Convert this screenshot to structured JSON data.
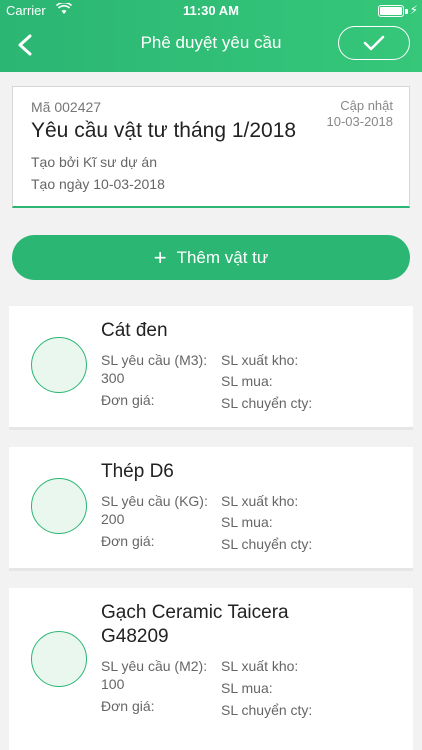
{
  "status_bar": {
    "carrier": "Carrier",
    "time": "11:30 AM"
  },
  "header": {
    "title": "Phê duyệt yêu cầu",
    "back_icon": "chevron-left-icon",
    "confirm_icon": "checkmark-icon"
  },
  "request": {
    "code": "Mã 002427",
    "title": "Yêu cầu vật tư tháng 1/2018",
    "updated_label": "Cập nhật",
    "updated_date": "10-03-2018",
    "created_by": "Tạo bởi Kĩ sư dự án",
    "created_date": "Tạo ngày 10-03-2018"
  },
  "add_button": {
    "label": "Thêm vật tư",
    "icon": "plus-icon"
  },
  "items": [
    {
      "name_line1": "Cát đen",
      "name_line2": "",
      "qty_label": "SL yêu cầu (M3):",
      "qty_value": "300",
      "price_label": "Đơn giá:",
      "export_label": "SL xuất kho:",
      "buy_label": "SL mua:",
      "transfer_label": "SL chuyển cty:"
    },
    {
      "name_line1": "Thép D6",
      "name_line2": "",
      "qty_label": "SL yêu cầu (KG):",
      "qty_value": "200",
      "price_label": "Đơn giá:",
      "export_label": "SL xuất kho:",
      "buy_label": "SL mua:",
      "transfer_label": "SL chuyển cty:"
    },
    {
      "name_line1": "Gạch Ceramic Taicera",
      "name_line2": "G48209",
      "qty_label": "SL yêu cầu (M2):",
      "qty_value": "100",
      "price_label": "Đơn giá:",
      "export_label": "SL xuất kho:",
      "buy_label": "SL mua:",
      "transfer_label": "SL chuyển cty:"
    }
  ],
  "colors": {
    "accent": "#2bb673",
    "circle_fill": "#e9f7ee"
  }
}
